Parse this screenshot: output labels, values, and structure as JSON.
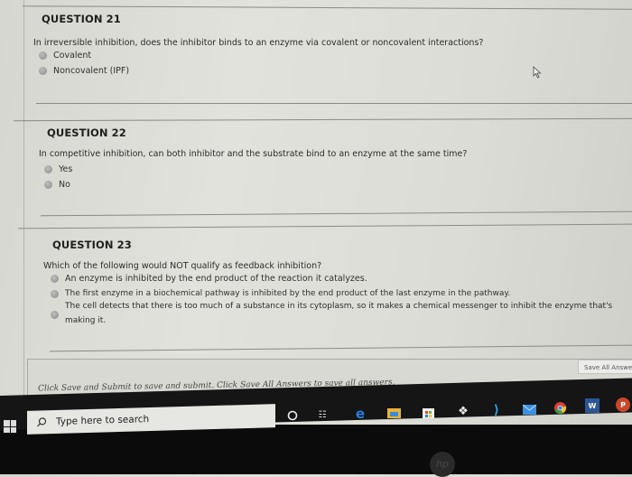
{
  "questions": [
    {
      "title": "QUESTION 21",
      "text": "In irreversible inhibition, does the inhibitor binds to an enzyme via covalent or noncovalent interactions?",
      "options": [
        "Covalent",
        "Noncovalent (IPF)"
      ]
    },
    {
      "title": "QUESTION 22",
      "text": "In competitive inhibition, can both inhibitor and the substrate bind to an enzyme at the same time?",
      "options": [
        "Yes",
        "No"
      ]
    },
    {
      "title": "QUESTION 23",
      "text": "Which of the following would NOT qualify as feedback inhibition?",
      "options": [
        "An enzyme is inhibited by the end product of the reaction it catalyzes.",
        "The first enzyme in a biochemical pathway is inhibited by the end product of the last enzyme in the pathway.",
        "The cell detects that there is too much of a substance in its cytoplasm, so it makes a chemical messenger to inhibit the enzyme that's",
        "making it."
      ]
    }
  ],
  "footer": {
    "instructions": "Click Save and Submit to save and submit. Click Save All Answers to save all answers.",
    "save_all_label": "Save All Answers"
  },
  "taskbar": {
    "search_placeholder": "Type here to search",
    "icons": [
      "cortana-icon",
      "task-view-icon",
      "edge-icon",
      "file-explorer-icon",
      "store-icon",
      "dropbox-icon",
      "visual-studio-icon",
      "mail-icon",
      "chrome-icon",
      "word-icon",
      "powerpoint-icon"
    ]
  },
  "brand": "hp"
}
